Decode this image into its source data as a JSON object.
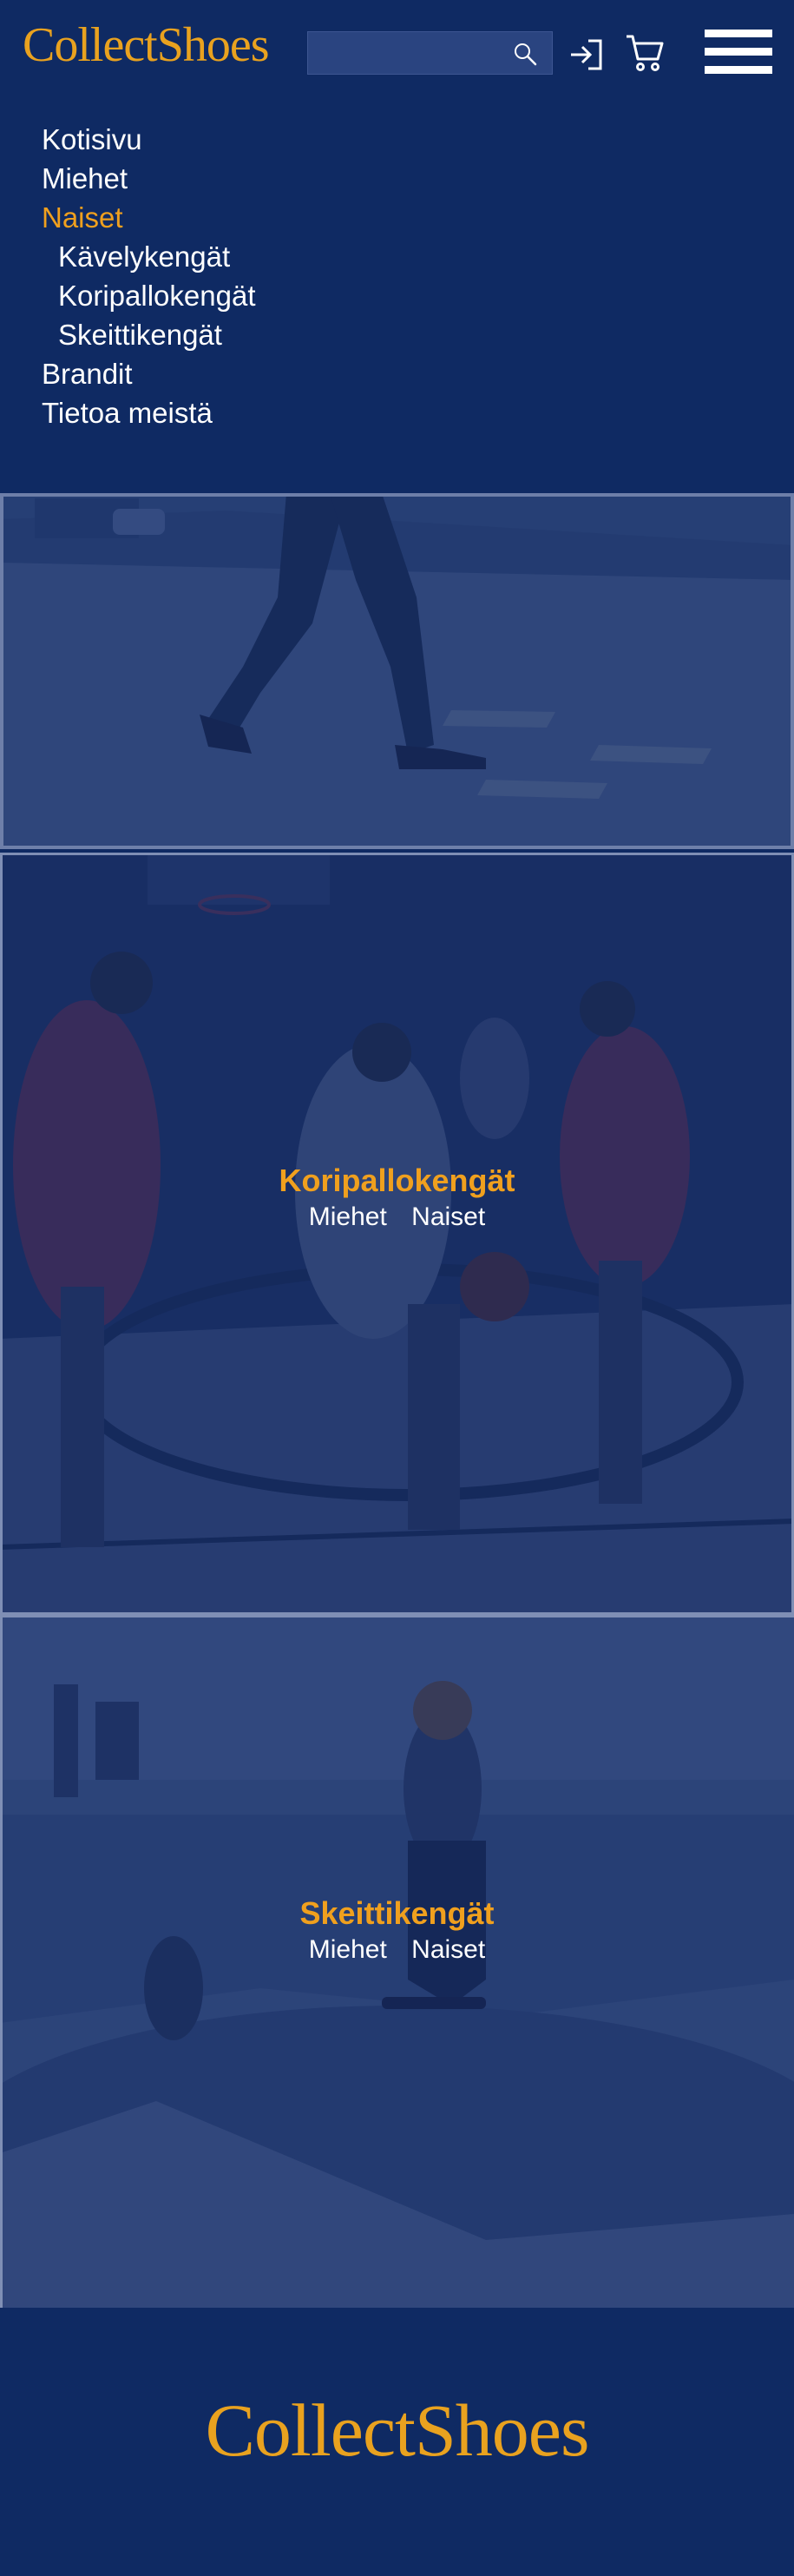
{
  "header": {
    "logo": "CollectShoes",
    "search": {
      "value": "",
      "placeholder": ""
    },
    "icons": [
      "search-icon",
      "login-icon",
      "cart-icon",
      "hamburger-menu-icon"
    ]
  },
  "menu": {
    "items": [
      {
        "label": "Kotisivu",
        "level": 0,
        "active": false
      },
      {
        "label": "Miehet",
        "level": 0,
        "active": false
      },
      {
        "label": "Naiset",
        "level": 0,
        "active": true
      },
      {
        "label": "Kävelykengät",
        "level": 1,
        "active": false
      },
      {
        "label": "Koripallokengät",
        "level": 1,
        "active": false
      },
      {
        "label": "Skeittikengät",
        "level": 1,
        "active": false
      },
      {
        "label": "Brandit",
        "level": 0,
        "active": false
      },
      {
        "label": "Tietoa meistä",
        "level": 0,
        "active": false
      }
    ]
  },
  "panels": {
    "basketball": {
      "title": "Koripallokengät",
      "men": "Miehet",
      "women": "Naiset"
    },
    "skate": {
      "title": "Skeittikengät",
      "men": "Miehet",
      "women": "Naiset"
    }
  },
  "footer": {
    "logo": "CollectShoes"
  },
  "colors": {
    "navy": "#0f2a63",
    "accent": "#f0a01e",
    "logo": "#e9a21f",
    "text": "#ffffff"
  }
}
